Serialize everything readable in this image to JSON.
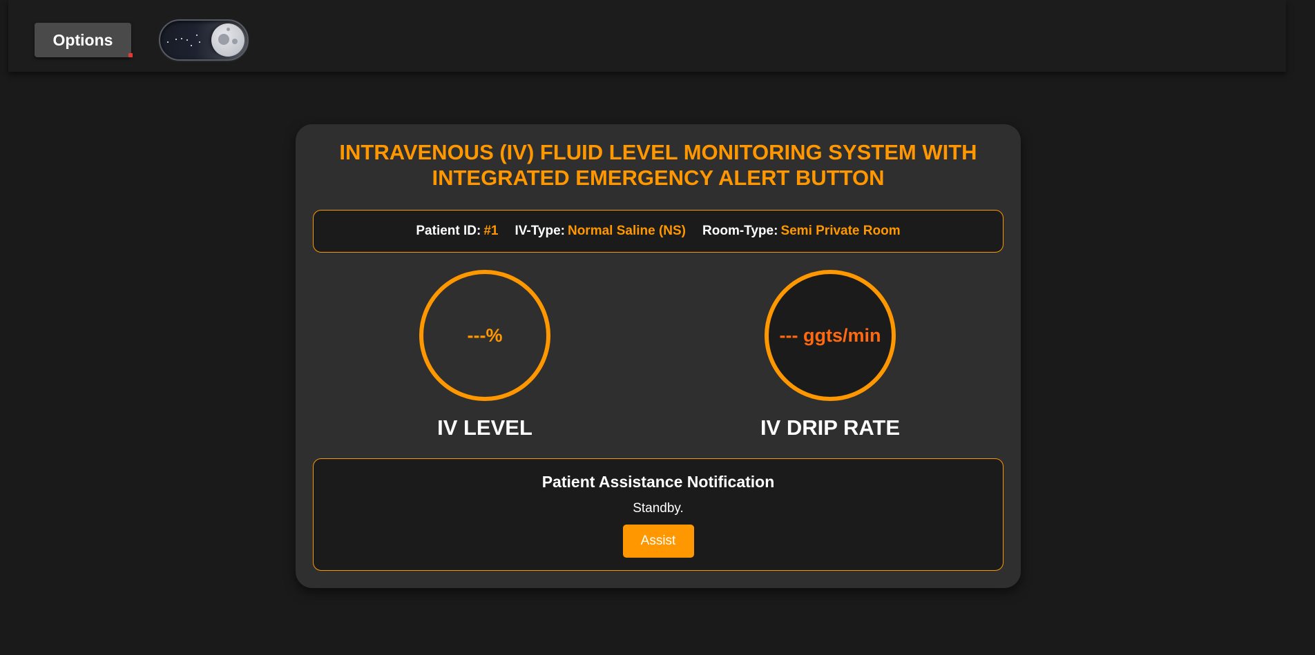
{
  "topbar": {
    "options_label": "Options",
    "theme_toggle_state": "dark"
  },
  "colors": {
    "accent": "#ff9800",
    "drip_text": "#ff6a10",
    "background": "#1a1a1a",
    "card": "#2f2f2f",
    "panel": "#1b1b1b"
  },
  "monitor": {
    "title": "INTRAVENOUS (IV) FLUID LEVEL MONITORING SYSTEM WITH INTEGRATED EMERGENCY ALERT BUTTON",
    "patient": {
      "id_label": "Patient ID:",
      "id_value": "#1",
      "iv_type_label": "IV-Type:",
      "iv_type_value": "Normal Saline (NS)",
      "room_type_label": "Room-Type:",
      "room_type_value": "Semi Private Room"
    },
    "iv_level": {
      "value": "---%",
      "label": "IV LEVEL"
    },
    "drip_rate": {
      "value": "--- ggts/min",
      "label": "IV DRIP RATE"
    },
    "assistance": {
      "title": "Patient Assistance Notification",
      "status": "Standby.",
      "button_label": "Assist"
    }
  }
}
